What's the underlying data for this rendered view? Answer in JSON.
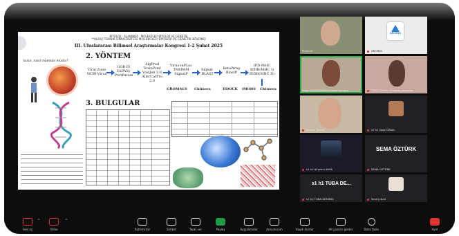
{
  "poster": {
    "header_line1": "BİYOLOJİ · ALANINDA · MOLEKÜLER BİYOLOJİ VE GENETİK",
    "header_line2": "*YILDIZ TEKNİK ÜNİVERSİTESİ MOLEKÜLER BİYOLOJİ VE GENETİK BÖLÜMÜ",
    "conference_title": "III. Uluslararası Bilimsel Araştırmalar Kongresi 1-2 Şubat 2025",
    "section_method": "2. YÖNTEM",
    "section_results": "3. BULGULAR",
    "left_question": "bulur, nasıl mümkün müdür?",
    "method_steps": [
      {
        "label": "Viral Zone\nNCBI-Virus"
      },
      {
        "label": "GOR IV\nExPASy\nProtParam"
      },
      {
        "label": "AlgPred\nToxinPred\nVaxiJen 2.0\nAllerCatPro\n2.0"
      },
      {
        "label": "Virus-mPLoc\nTMHMM\nSignalP"
      },
      {
        "label": "Signal-\nBLAST"
      },
      {
        "label": "BetaWrap\nBlastP"
      },
      {
        "label": "IPD-MHC\nIEDB(MHC I)\nIEDB(MHC II)"
      },
      {
        "label": "GROMACS"
      },
      {
        "label": "Chimera"
      },
      {
        "label": "HDOCK"
      },
      {
        "label": "iMODS"
      },
      {
        "label": "Chimera"
      }
    ],
    "left_text": "virüsün bir örneğidir... HERKEN... ve LEFKENNA ADLNLI..."
  },
  "participants": [
    {
      "name": "Mehmet ...",
      "speaking": false
    },
    {
      "name": "ARCENG",
      "speaking": false
    },
    {
      "name": "Rüya Gül KARAYANI (Poster Sunum)",
      "speaking": true
    },
    {
      "name": "Zeliha Gülten bölümü yazılımlar",
      "speaking": false
    },
    {
      "name": "Serkan Tezcan",
      "speaking": false
    },
    {
      "name": "s1 h1 Ayşe ÖZKAL",
      "speaking": false
    },
    {
      "name": "s1 h1 Aliyenur KAYA",
      "speaking": false
    },
    {
      "name": "SEMA ÖZTÜRK",
      "speaking": false
    },
    {
      "name": "s1 h1 TUBA DEMİREL",
      "speaking": false
    },
    {
      "name": "Sevil Juhed",
      "speaking": false
    }
  ],
  "tiles_big_text": {
    "sema": "SEMA ÖZTÜRK",
    "tuba": "s1 h1 TUBA DE..."
  },
  "logo_text": "ARCENG",
  "toolbar": {
    "items": [
      {
        "label": "Sesi aç",
        "icon": "mic-muted-icon"
      },
      {
        "label": "Video",
        "icon": "video-muted-icon"
      },
      {
        "label": "Katılımcılar",
        "icon": "participants-icon"
      },
      {
        "label": "Sohbet",
        "icon": "chat-icon"
      },
      {
        "label": "Tepki ver",
        "icon": "react-icon"
      },
      {
        "label": "Paylaş",
        "icon": "share-icon"
      },
      {
        "label": "Uygulamalar",
        "icon": "apps-icon"
      },
      {
        "label": "Ana oturum",
        "icon": "breakout-icon"
      },
      {
        "label": "Kaydı durdur",
        "icon": "record-icon"
      },
      {
        "label": "Alt yazıları göster",
        "icon": "captions-icon"
      },
      {
        "label": "Daha fazla",
        "icon": "more-icon"
      },
      {
        "label": "Ayrıl",
        "icon": "leave-icon"
      }
    ],
    "participants_count": "10"
  },
  "colors": {
    "speaking_border": "#27b24a",
    "share_green": "#1f9a49",
    "muted_red": "#e0342d",
    "arrow_blue": "#2f62c7"
  }
}
